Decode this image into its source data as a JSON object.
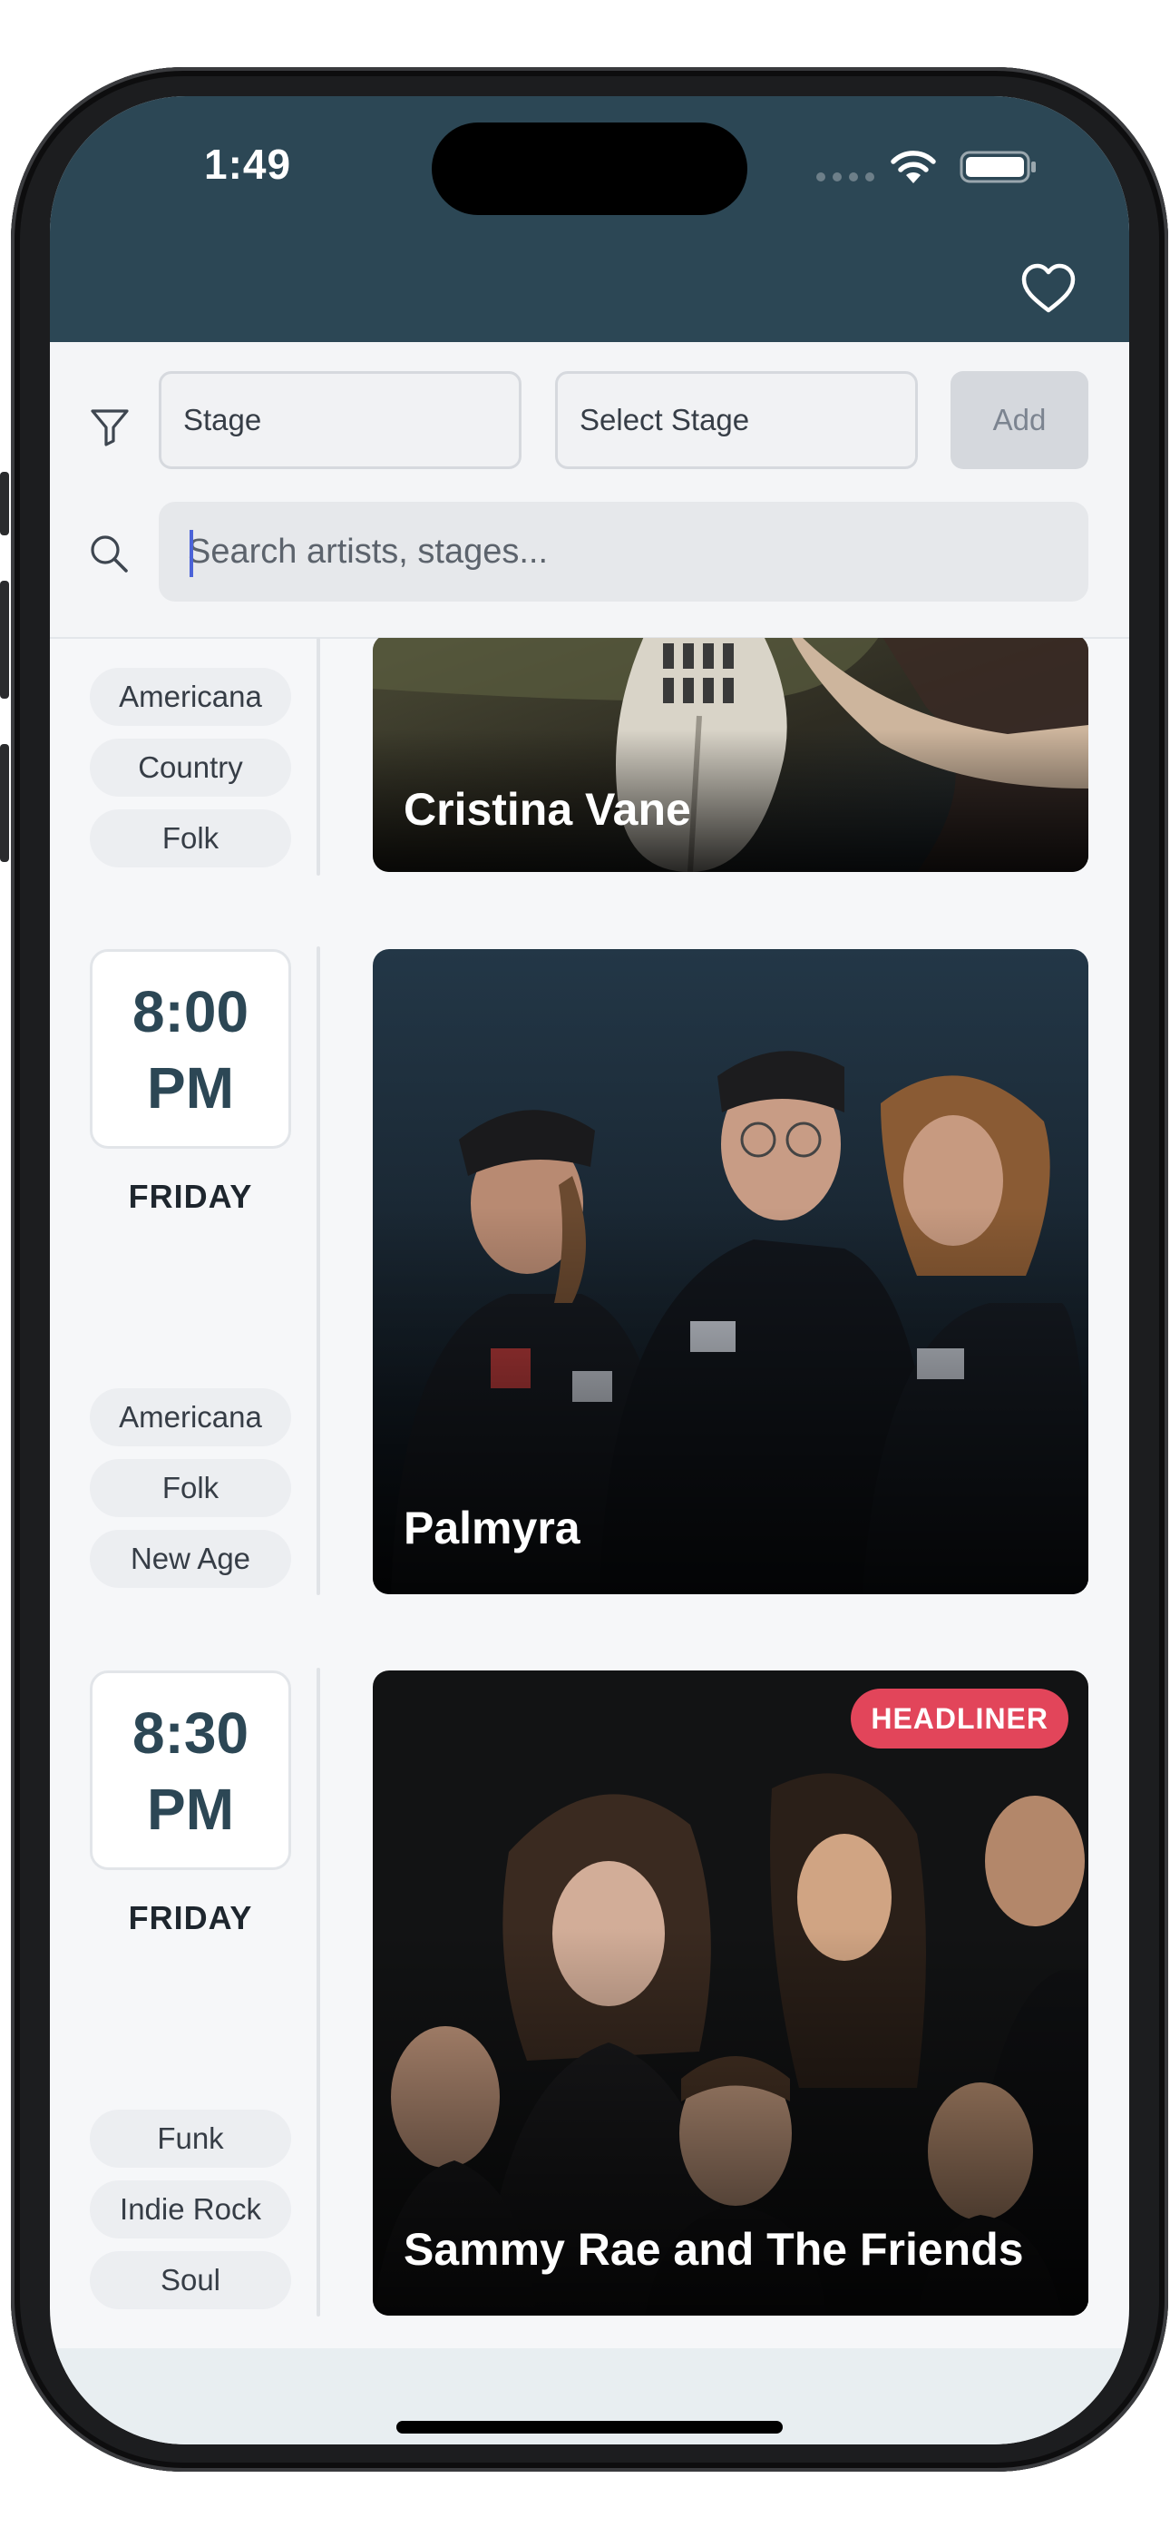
{
  "status_bar": {
    "time": "1:49"
  },
  "filters": {
    "stage_field": "Stage",
    "select_stage": "Select Stage",
    "add_label": "Add"
  },
  "search": {
    "placeholder": "Search artists, stages..."
  },
  "schedule": [
    {
      "artist": "Cristina Vane",
      "genres": [
        "Americana",
        "Country",
        "Folk"
      ]
    },
    {
      "time_line1": "8:00",
      "time_line2": "PM",
      "day": "FRIDAY",
      "artist": "Palmyra",
      "genres": [
        "Americana",
        "Folk",
        "New Age"
      ]
    },
    {
      "time_line1": "8:30",
      "time_line2": "PM",
      "day": "FRIDAY",
      "artist": "Sammy Rae and The Friends",
      "badge": "HEADLINER",
      "genres": [
        "Funk",
        "Indie Rock",
        "Soul"
      ]
    }
  ],
  "icons": {
    "favorites": "heart-icon",
    "filter": "funnel-icon",
    "search": "search-icon"
  },
  "colors": {
    "header": "#2c4755",
    "headliner_badge": "#e2455a",
    "time_text": "#2c4755"
  }
}
